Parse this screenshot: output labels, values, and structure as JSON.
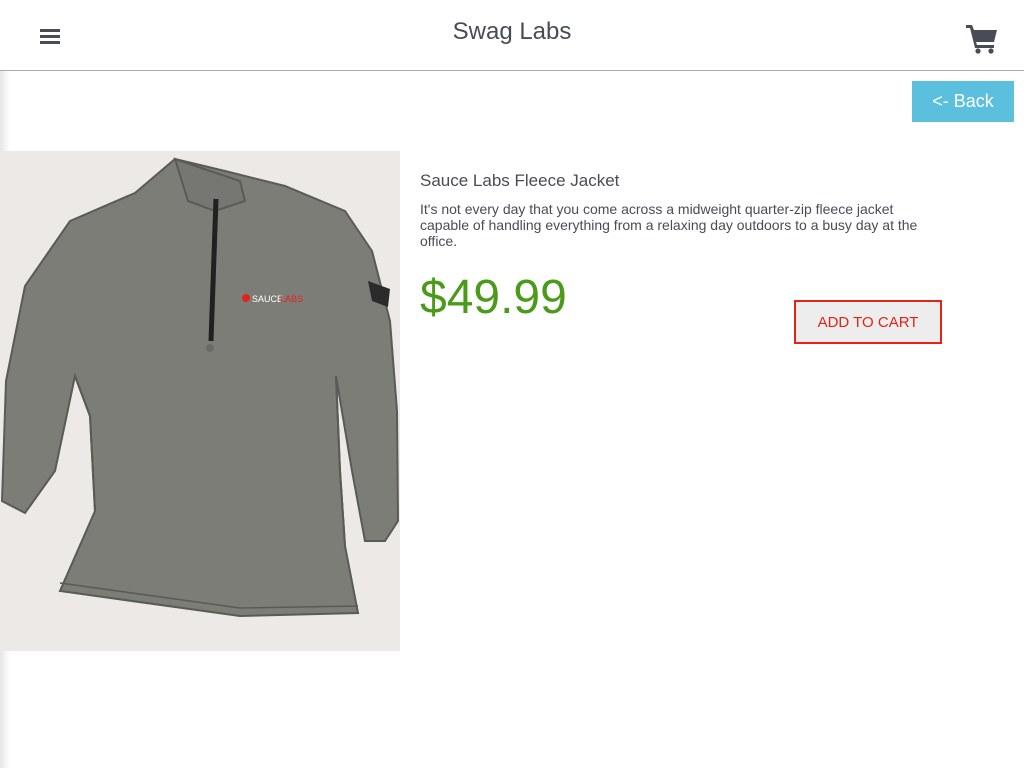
{
  "header": {
    "title": "Swag Labs",
    "menu_icon": "hamburger-menu-icon",
    "cart_icon": "shopping-cart-icon"
  },
  "navigation": {
    "back_label": "<- Back"
  },
  "product": {
    "name": "Sauce Labs Fleece Jacket",
    "description": "It's not every day that you come across a midweight quarter-zip fleece jacket capable of handling everything from a relaxing day outdoors to a busy day at the office.",
    "price": "$49.99",
    "image_alt": "Sauce Labs Fleece Jacket",
    "add_to_cart_label": "ADD TO CART"
  },
  "colors": {
    "price_green": "#4c9a1a",
    "back_button_blue": "#5bc0de",
    "add_button_red": "#e2231a",
    "text_gray": "#484c55"
  }
}
